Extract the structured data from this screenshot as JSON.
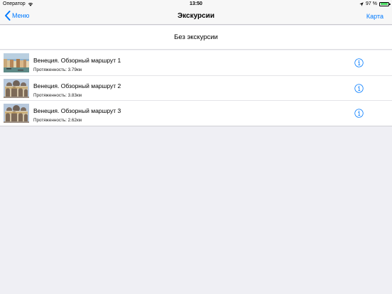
{
  "status": {
    "carrier": "Оператор",
    "time": "13:50",
    "battery_text": "97 %",
    "battery_level": 0.97,
    "icons": [
      "wifi-icon",
      "location-icon",
      "battery-icon"
    ]
  },
  "navbar": {
    "back_label": "Меню",
    "title": "Экскурсии",
    "right_label": "Карта"
  },
  "no_tour_label": "Без экскурсии",
  "tours": [
    {
      "name": "Венеция. Обзорный маршрут 1",
      "length": "Протяженность: 3.79км",
      "thumb": "grand-canal"
    },
    {
      "name": "Венеция. Обзорный маршрут 2",
      "length": "Протяженность: 3.83км",
      "thumb": "san-marco"
    },
    {
      "name": "Венеция. Обзорный маршрут 3",
      "length": "Протяженность: 2.62км",
      "thumb": "san-marco"
    }
  ],
  "colors": {
    "accent": "#007aff",
    "background": "#efeff4",
    "battery": "#4cd964"
  }
}
